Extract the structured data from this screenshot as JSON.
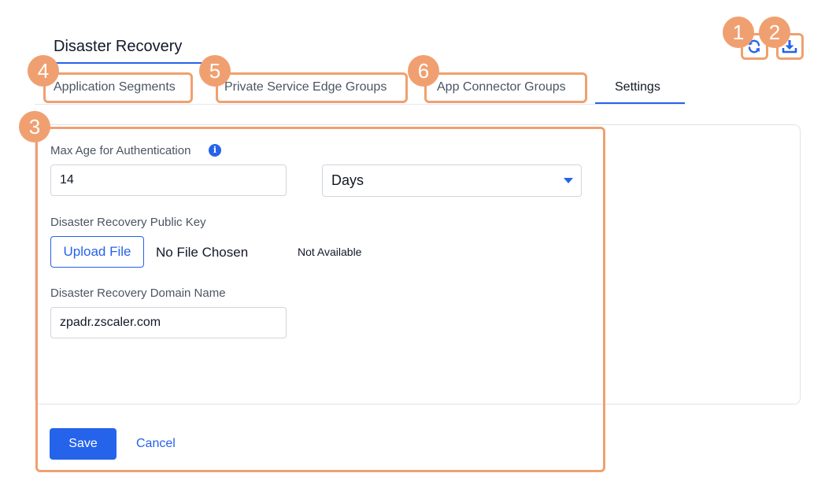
{
  "header": {
    "title": "Disaster Recovery"
  },
  "tabs": [
    {
      "label": "Application Segments",
      "active": false
    },
    {
      "label": "Private Service Edge Groups",
      "active": false
    },
    {
      "label": "App Connector Groups",
      "active": false
    },
    {
      "label": "Settings",
      "active": true
    }
  ],
  "toolbar": {
    "refresh_icon": "refresh-icon",
    "download_icon": "download-icon"
  },
  "callouts": [
    "1",
    "2",
    "3",
    "4",
    "5",
    "6"
  ],
  "form": {
    "max_age": {
      "label": "Max Age for Authentication",
      "info_icon": "info-icon",
      "value": "14",
      "unit_selected": "Days"
    },
    "public_key": {
      "label": "Disaster Recovery Public Key",
      "upload_label": "Upload File",
      "file_status": "No File Chosen",
      "availability": "Not Available"
    },
    "domain": {
      "label": "Disaster Recovery Domain Name",
      "value": "zpadr.zscaler.com"
    }
  },
  "actions": {
    "save_label": "Save",
    "cancel_label": "Cancel"
  },
  "colors": {
    "accent": "#2563eb",
    "callout": "#f0a070"
  }
}
